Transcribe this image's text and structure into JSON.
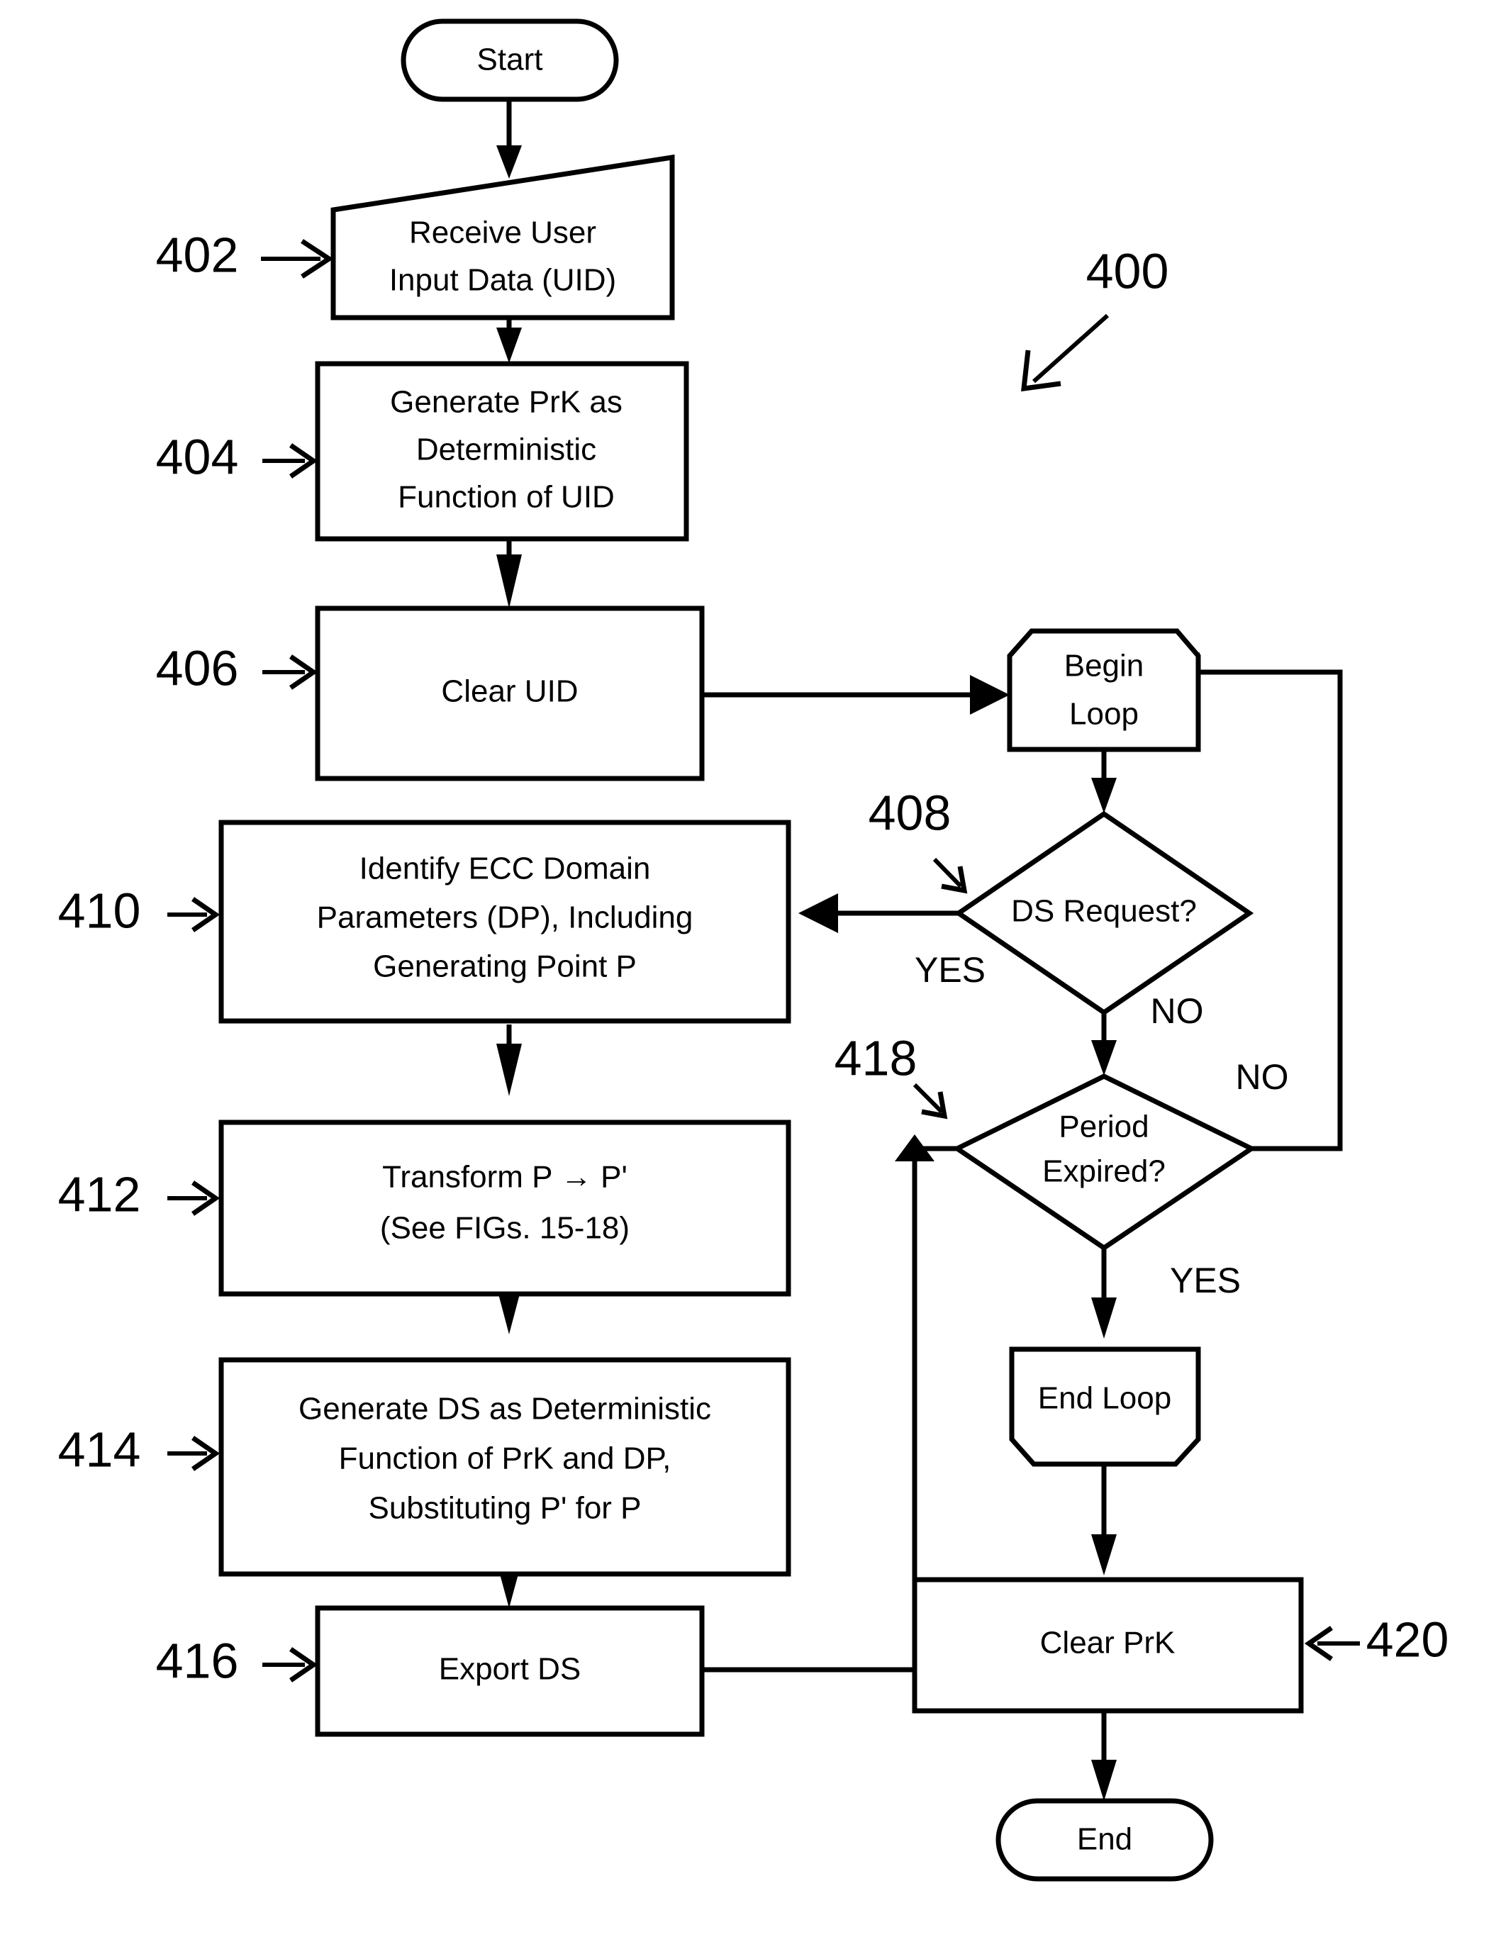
{
  "figure": {
    "label": "400",
    "type": "flowchart"
  },
  "nodes": {
    "start": {
      "label": "Start",
      "shape": "terminator"
    },
    "receive_uid": {
      "ref": "402",
      "line1": "Receive User",
      "line2": "Input Data (UID)",
      "shape": "input-slanted-top"
    },
    "generate_prk": {
      "ref": "404",
      "line1": "Generate PrK as",
      "line2": "Deterministic",
      "line3": "Function of UID",
      "shape": "process"
    },
    "clear_uid": {
      "ref": "406",
      "line1": "Clear UID",
      "shape": "process"
    },
    "begin_loop": {
      "line1": "Begin",
      "line2": "Loop",
      "shape": "loop-start"
    },
    "ds_request": {
      "ref": "408",
      "line1": "DS Request?",
      "shape": "decision",
      "yes_label": "YES",
      "no_label": "NO"
    },
    "identify_ecc": {
      "ref": "410",
      "line1": "Identify ECC Domain",
      "line2": "Parameters (DP), Including",
      "line3": "Generating Point P",
      "shape": "process"
    },
    "transform_p": {
      "ref": "412",
      "line1": "Transform P → P'",
      "line2": "(See FIGs. 15-18)",
      "shape": "process"
    },
    "generate_ds": {
      "ref": "414",
      "line1": "Generate DS as Deterministic",
      "line2": "Function of PrK and DP,",
      "line3": "Substituting P' for P",
      "shape": "process"
    },
    "export_ds": {
      "ref": "416",
      "line1": "Export DS",
      "shape": "process"
    },
    "period_expired": {
      "ref": "418",
      "line1": "Period",
      "line2": "Expired?",
      "shape": "decision",
      "yes_label": "YES",
      "no_label": "NO"
    },
    "end_loop": {
      "line1": "End Loop",
      "shape": "loop-end"
    },
    "clear_prk": {
      "ref": "420",
      "line1": "Clear PrK",
      "shape": "process"
    },
    "end": {
      "label": "End",
      "shape": "terminator"
    }
  },
  "colors": {
    "stroke": "#000000",
    "fill": "#ffffff",
    "background": "#ffffff"
  }
}
